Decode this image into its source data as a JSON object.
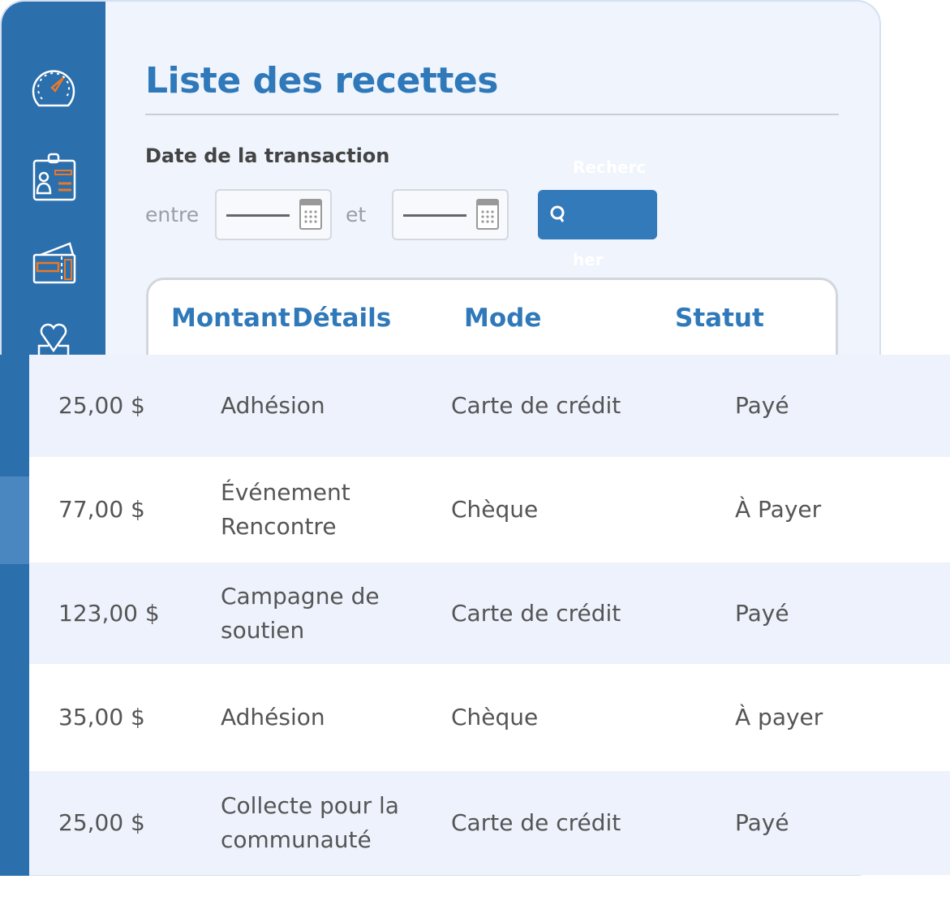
{
  "sidebar": {
    "items": [
      {
        "icon": "dashboard-gauge-icon"
      },
      {
        "icon": "member-id-card-icon"
      },
      {
        "icon": "ticket-icon"
      },
      {
        "icon": "donation-heart-icon"
      }
    ]
  },
  "page": {
    "title": "Liste des recettes"
  },
  "filter": {
    "label": "Date de la transaction",
    "between": "entre",
    "and": "et",
    "search_label_top": "Recherc",
    "search_label_bottom": "her"
  },
  "table": {
    "headers": [
      "Montant",
      "Détails",
      "Mode",
      "Statut"
    ],
    "rows": [
      {
        "amount": "25,00 $",
        "details": "Adhésion",
        "mode": "Carte de crédit",
        "status": "Payé"
      },
      {
        "amount": "77,00 $",
        "details": "Événement Rencontre",
        "mode": "Chèque",
        "status": "À Payer"
      },
      {
        "amount": "123,00 $",
        "details": "Campagne de soutien",
        "mode": "Carte de crédit",
        "status": "Payé"
      },
      {
        "amount": "35,00 $",
        "details": "Adhésion",
        "mode": "Chèque",
        "status": "À payer"
      },
      {
        "amount": "25,00 $",
        "details": "Collecte pour la communauté",
        "mode": "Carte de crédit",
        "status": "Payé"
      }
    ]
  },
  "colors": {
    "primary": "#2b6fad",
    "accent": "#e8792a",
    "title": "#2f78b9"
  }
}
